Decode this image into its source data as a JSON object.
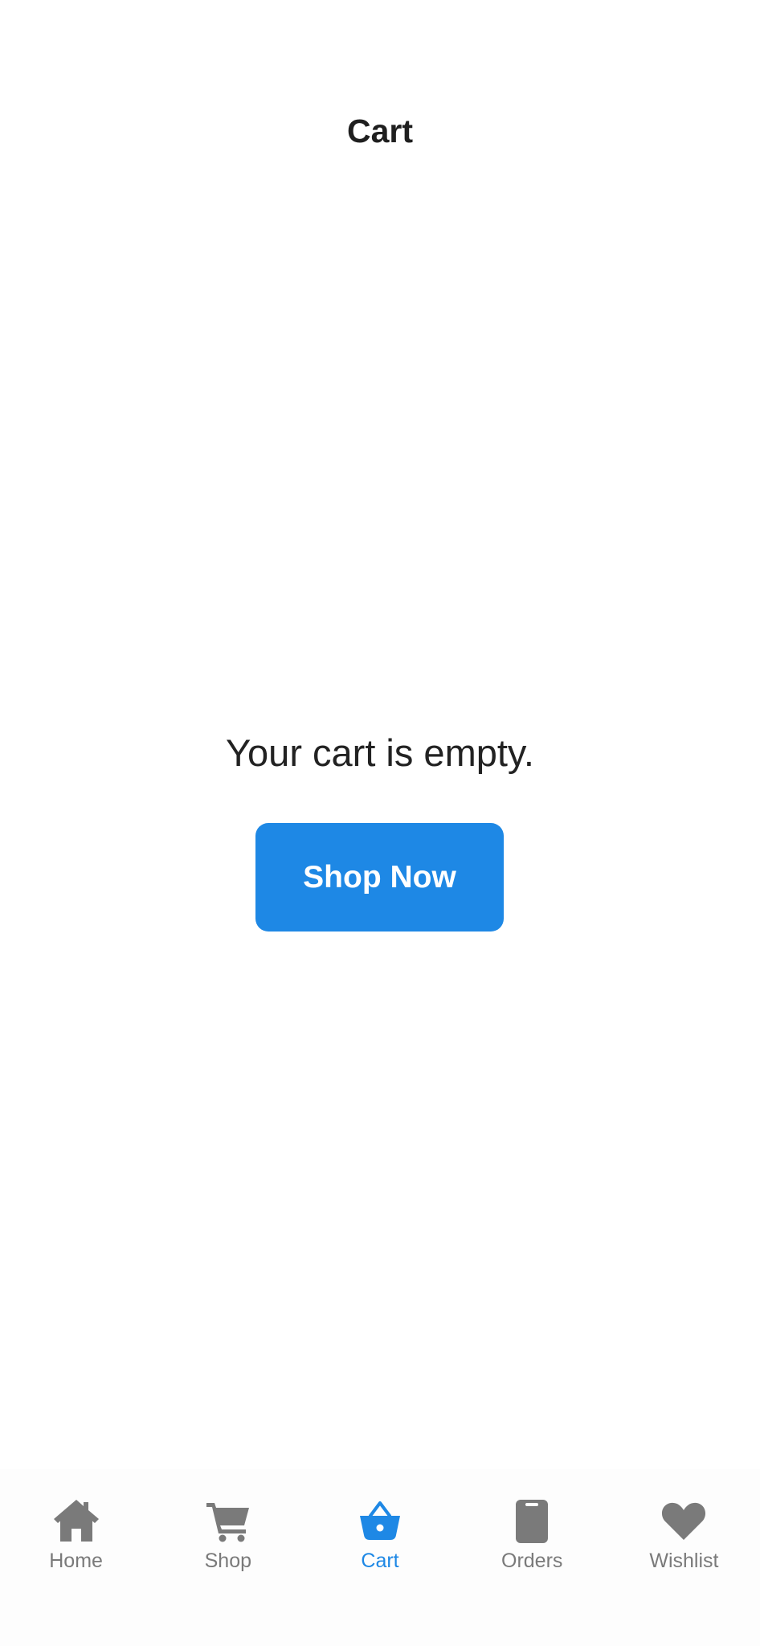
{
  "header": {
    "title": "Cart"
  },
  "empty_state": {
    "message": "Your cart is empty.",
    "button_label": "Shop Now"
  },
  "colors": {
    "accent": "#1e88e5",
    "inactive_icon": "#7a7a7a",
    "text": "#1f1f1f"
  },
  "tab_bar": {
    "items": [
      {
        "label": "Home",
        "icon": "home-icon",
        "active": false
      },
      {
        "label": "Shop",
        "icon": "shopping-cart-icon",
        "active": false
      },
      {
        "label": "Cart",
        "icon": "basket-icon",
        "active": true
      },
      {
        "label": "Orders",
        "icon": "clipboard-icon",
        "active": false
      },
      {
        "label": "Wishlist",
        "icon": "heart-icon",
        "active": false
      }
    ]
  }
}
